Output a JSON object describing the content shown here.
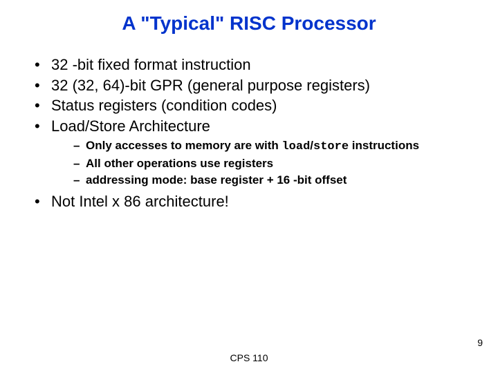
{
  "title": "A \"Typical\" RISC Processor",
  "bullets": {
    "b0": "32 -bit fixed format instruction",
    "b1": "32 (32, 64)-bit GPR (general purpose registers)",
    "b2": "Status registers (condition codes)",
    "b3": "Load/Store Architecture",
    "sub0_pre": "Only accesses to memory are with ",
    "sub0_code1": "load",
    "sub0_mid": "/",
    "sub0_code2": "store",
    "sub0_post": " instructions",
    "sub1": "All other operations use registers",
    "sub2": "addressing mode: base register + 16 -bit offset",
    "b4": "Not Intel x 86 architecture!"
  },
  "footer": {
    "center": "CPS 110",
    "page": "9"
  }
}
